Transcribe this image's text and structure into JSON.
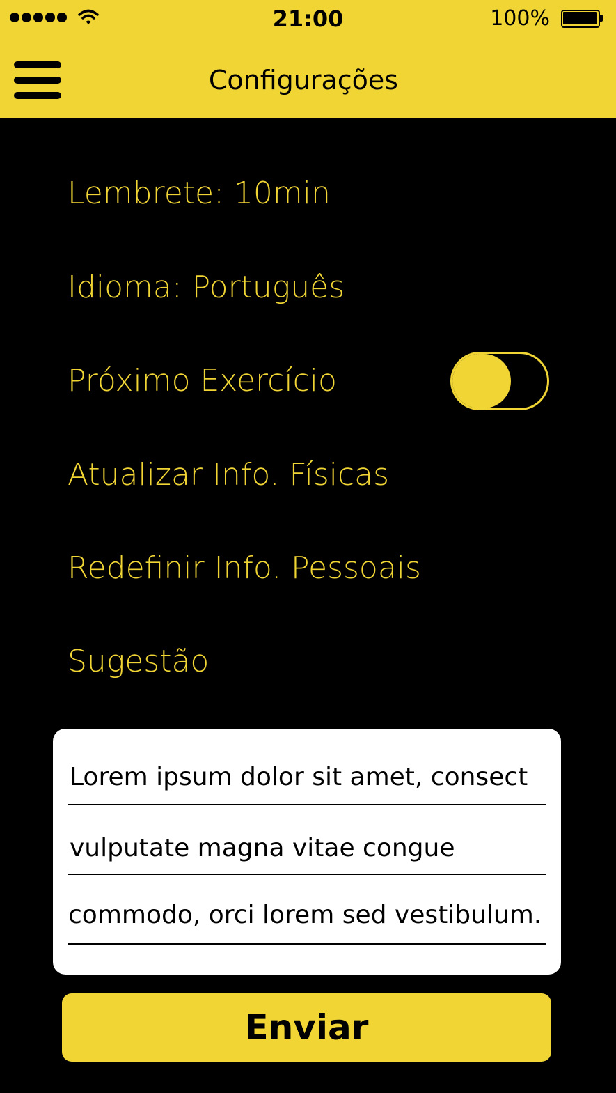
{
  "status_bar": {
    "time": "21:00",
    "battery": "100%",
    "signal_icon": "signal-dots-icon",
    "wifi_icon": "wifi-icon",
    "battery_icon": "battery-icon"
  },
  "nav": {
    "title": "Configurações",
    "menu_icon": "hamburger-menu-icon"
  },
  "settings": {
    "reminder": "Lembrete: 10min",
    "language": "Idioma: Português",
    "next_exercise": "Próximo Exercício",
    "next_exercise_enabled": true,
    "update_physical": "Atualizar Info. Físicas",
    "reset_personal": "Redefinir Info. Pessoais",
    "suggestion": "Sugestão"
  },
  "suggestion_box": {
    "lines": [
      "Lorem ipsum dolor sit amet, consect",
      "vulputate magna vitae congue",
      "commodo, orci lorem sed vestibulum."
    ]
  },
  "send_button": {
    "label": "Enviar"
  },
  "colors": {
    "accent": "#F0D535",
    "background": "#000000",
    "card": "#FFFFFF"
  }
}
